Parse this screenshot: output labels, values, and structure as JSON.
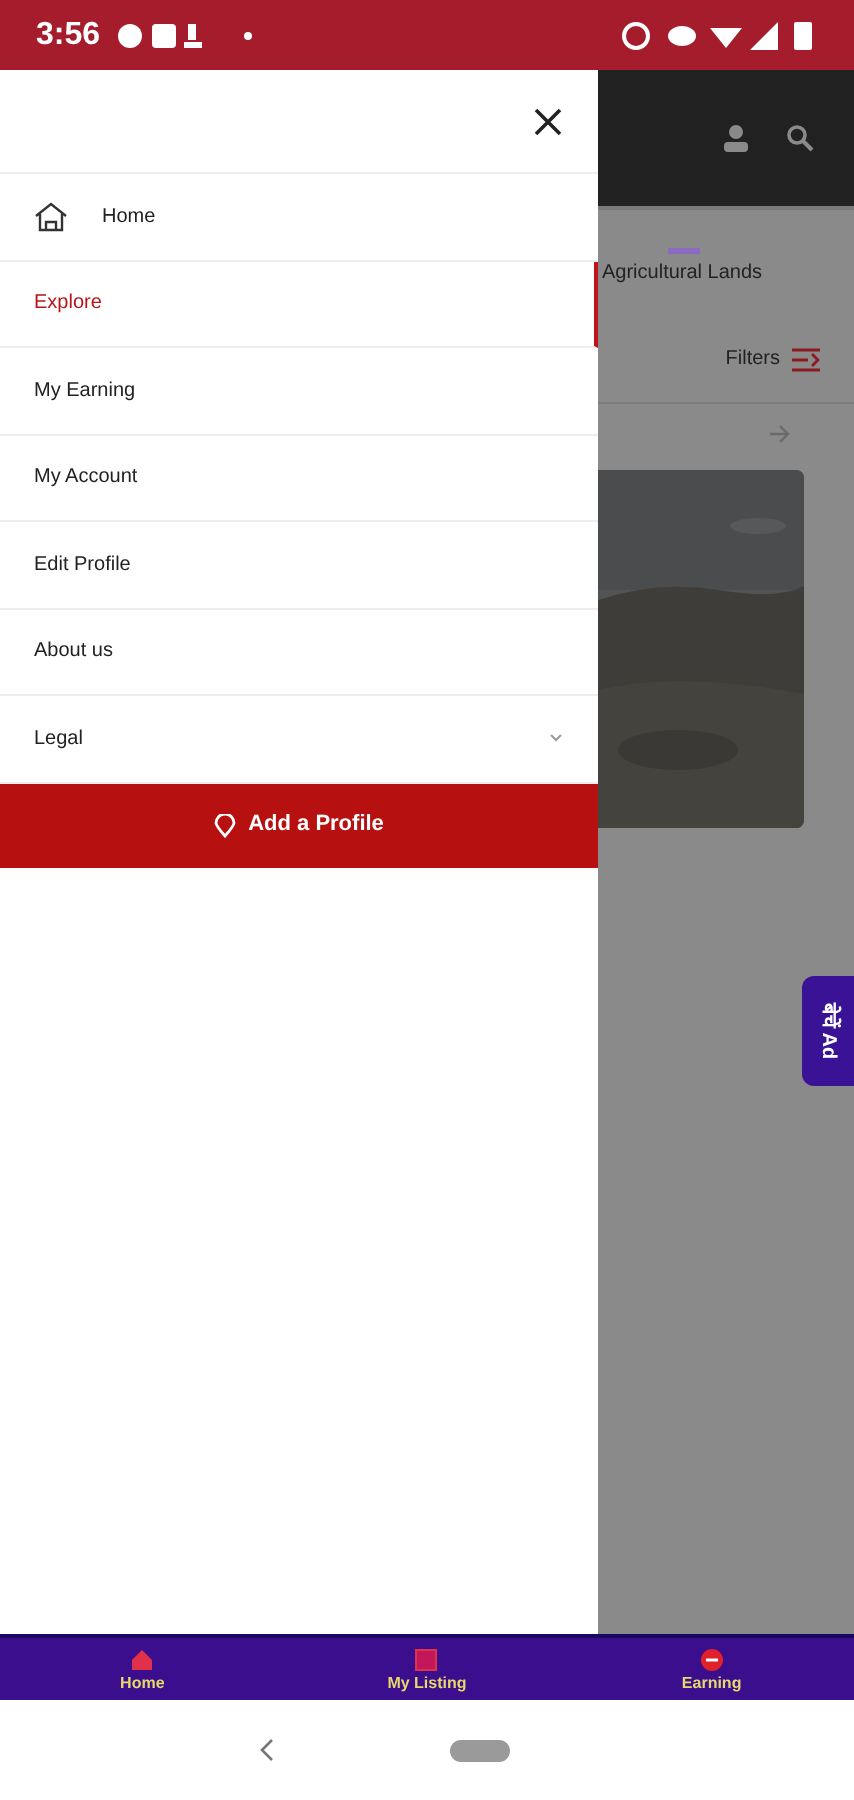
{
  "status_bar": {
    "time": "3:56"
  },
  "drawer": {
    "items": [
      {
        "label": "Home",
        "kind": "icon",
        "selected": false
      },
      {
        "label": "Explore",
        "kind": "plain",
        "selected": true
      },
      {
        "label": "My Earning",
        "kind": "plain",
        "selected": false
      },
      {
        "label": "My Account",
        "kind": "plain",
        "selected": false
      },
      {
        "label": "Edit Profile",
        "kind": "plain",
        "selected": false
      },
      {
        "label": "About us",
        "kind": "plain",
        "selected": false
      },
      {
        "label": "Legal",
        "kind": "expandable",
        "selected": false
      }
    ],
    "button": "Add a Profile"
  },
  "background": {
    "category": "Agricultural Lands",
    "filters": "Filters",
    "side_tab": "बेचें Ad"
  },
  "bottom_nav": [
    {
      "label": "Home",
      "kind": "home"
    },
    {
      "label": "My Listing",
      "kind": "listing"
    },
    {
      "label": "Earning",
      "kind": "earning"
    }
  ]
}
